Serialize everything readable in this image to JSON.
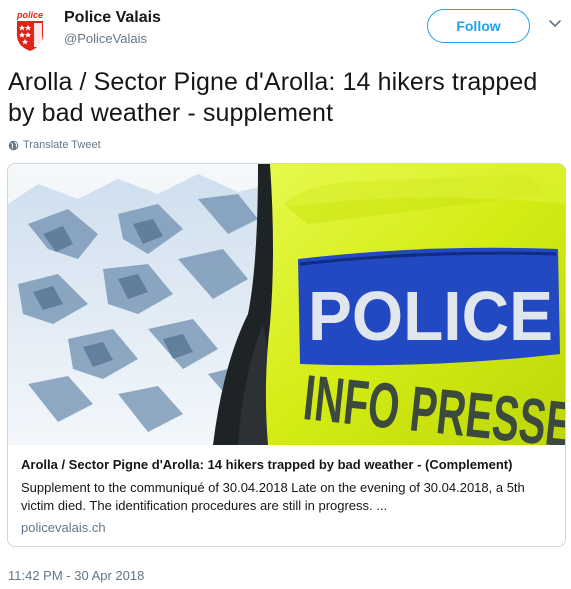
{
  "author": {
    "name": "Police Valais",
    "handle": "@PoliceValais",
    "avatar_text": "police"
  },
  "header": {
    "follow_label": "Follow",
    "menu_icon": "chevron-down-icon"
  },
  "tweet": {
    "text": "Arolla / Sector Pigne d'Arolla: 14 hikers trapped by bad weather - supplement",
    "translate_label": "Translate Tweet",
    "timestamp": "11:42 PM - 30 Apr 2018"
  },
  "card": {
    "image_text_top": "POLICE",
    "image_text_bottom": "INFO PRESSE",
    "title": "Arolla / Sector Pigne d'Arolla: 14 hikers trapped by bad weather - (Complement)",
    "description": "Supplement to the communiqué of 30.04.2018 Late on the evening of 30.04.2018, a 5th victim died. The identification procedures are still in progress. ...",
    "domain": "policevalais.ch"
  },
  "colors": {
    "accent": "#1da1f2",
    "text": "#14171a",
    "muted": "#657786",
    "border": "#ccd6dd",
    "vest_yellow": "#d8ef1e",
    "police_blue": "#1f4fb8",
    "brand_red": "#e2231a"
  }
}
